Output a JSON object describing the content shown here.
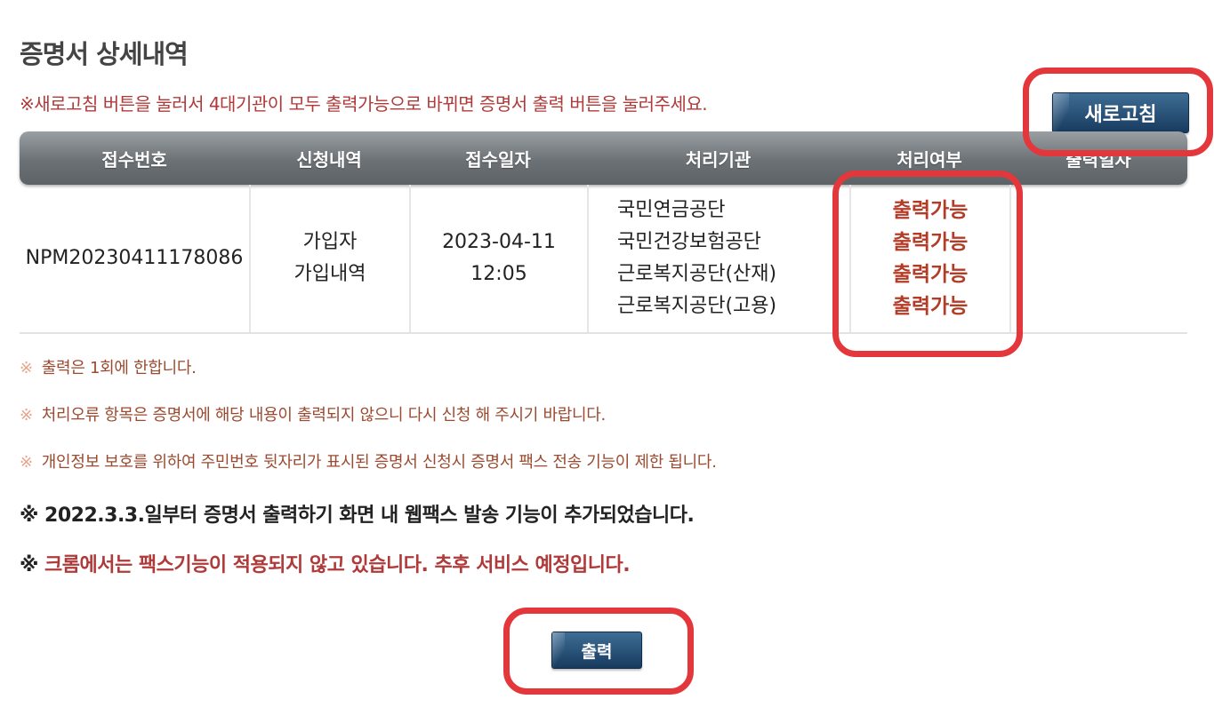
{
  "page": {
    "title": "증명서 상세내역",
    "notice": "※새로고침 버튼을 눌러서 4대기관이 모두 출력가능으로 바뀌면 증명서 출력 버튼을 눌러주세요.",
    "refresh_label": "새로고침",
    "print_label": "출력"
  },
  "table": {
    "headers": [
      "접수번호",
      "신청내역",
      "접수일자",
      "처리기관",
      "처리여부",
      "출력일자"
    ],
    "row": {
      "receipt_no": "NPM20230411178086",
      "request_line1": "가입자",
      "request_line2": "가입내역",
      "date_line1": "2023-04-11",
      "date_line2": "12:05",
      "agencies": [
        "국민연금공단",
        "국민건강보험공단",
        "근로복지공단(산재)",
        "근로복지공단(고용)"
      ],
      "statuses": [
        "출력가능",
        "출력가능",
        "출력가능",
        "출력가능"
      ],
      "print_date": ""
    }
  },
  "notes": [
    "출력은 1회에 한합니다.",
    "처리오류 항목은 증명서에 해당 내용이 출력되지 않으니 다시 신청 해 주시기 바랍니다.",
    "개인정보 보호를 위하여 주민번호 뒷자리가 표시된 증명서 신청시 증명서 팩스 전송 기능이 제한 됩니다."
  ],
  "note_mark": "※",
  "bold_notes": {
    "fax_added": "※ 2022.3.3.일부터 증명서 출력하기 화면 내 웹팩스 발송 기능이 추가되었습니다.",
    "chrome_prefix": "※ ",
    "chrome_text": "크롬에서는 팩스기능이 적용되지 않고 있습니다. 추후 서비스 예정입니다."
  },
  "colors": {
    "highlight": "#e4373c",
    "status_text": "#b43c27",
    "notice_text": "#b03a3a",
    "button": "#1f4a72"
  }
}
